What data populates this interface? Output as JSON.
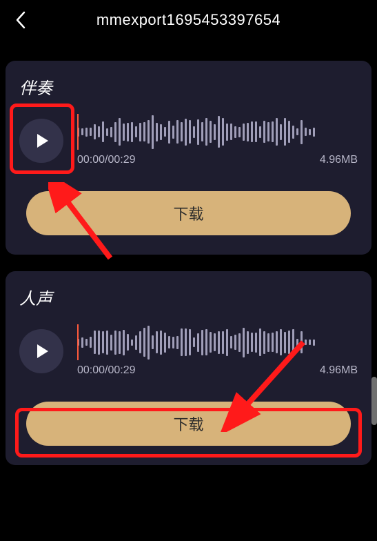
{
  "header": {
    "title": "mmexport1695453397654"
  },
  "tracks": [
    {
      "title": "伴奏",
      "time": "00:00/00:29",
      "size": "4.96MB",
      "download_label": "下载"
    },
    {
      "title": "人声",
      "time": "00:00/00:29",
      "size": "4.96MB",
      "download_label": "下载"
    }
  ]
}
